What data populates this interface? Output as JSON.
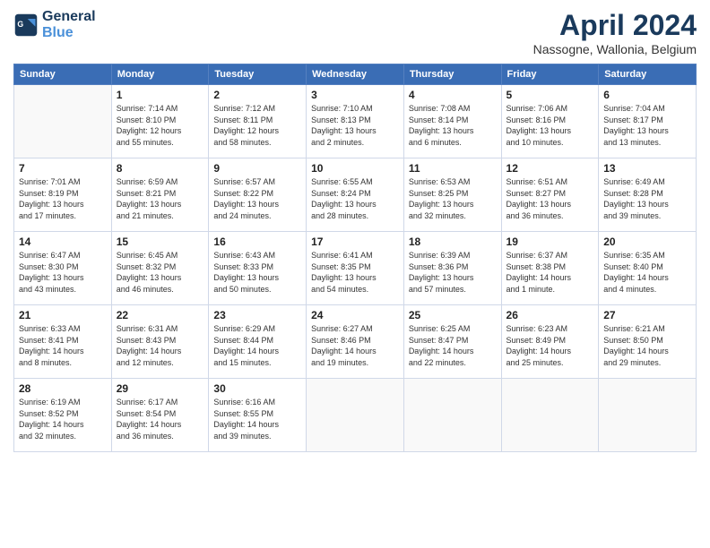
{
  "logo": {
    "line1": "General",
    "line2": "Blue"
  },
  "title": "April 2024",
  "location": "Nassogne, Wallonia, Belgium",
  "days_of_week": [
    "Sunday",
    "Monday",
    "Tuesday",
    "Wednesday",
    "Thursday",
    "Friday",
    "Saturday"
  ],
  "weeks": [
    [
      {
        "day": "",
        "info": ""
      },
      {
        "day": "1",
        "info": "Sunrise: 7:14 AM\nSunset: 8:10 PM\nDaylight: 12 hours\nand 55 minutes."
      },
      {
        "day": "2",
        "info": "Sunrise: 7:12 AM\nSunset: 8:11 PM\nDaylight: 12 hours\nand 58 minutes."
      },
      {
        "day": "3",
        "info": "Sunrise: 7:10 AM\nSunset: 8:13 PM\nDaylight: 13 hours\nand 2 minutes."
      },
      {
        "day": "4",
        "info": "Sunrise: 7:08 AM\nSunset: 8:14 PM\nDaylight: 13 hours\nand 6 minutes."
      },
      {
        "day": "5",
        "info": "Sunrise: 7:06 AM\nSunset: 8:16 PM\nDaylight: 13 hours\nand 10 minutes."
      },
      {
        "day": "6",
        "info": "Sunrise: 7:04 AM\nSunset: 8:17 PM\nDaylight: 13 hours\nand 13 minutes."
      }
    ],
    [
      {
        "day": "7",
        "info": "Sunrise: 7:01 AM\nSunset: 8:19 PM\nDaylight: 13 hours\nand 17 minutes."
      },
      {
        "day": "8",
        "info": "Sunrise: 6:59 AM\nSunset: 8:21 PM\nDaylight: 13 hours\nand 21 minutes."
      },
      {
        "day": "9",
        "info": "Sunrise: 6:57 AM\nSunset: 8:22 PM\nDaylight: 13 hours\nand 24 minutes."
      },
      {
        "day": "10",
        "info": "Sunrise: 6:55 AM\nSunset: 8:24 PM\nDaylight: 13 hours\nand 28 minutes."
      },
      {
        "day": "11",
        "info": "Sunrise: 6:53 AM\nSunset: 8:25 PM\nDaylight: 13 hours\nand 32 minutes."
      },
      {
        "day": "12",
        "info": "Sunrise: 6:51 AM\nSunset: 8:27 PM\nDaylight: 13 hours\nand 36 minutes."
      },
      {
        "day": "13",
        "info": "Sunrise: 6:49 AM\nSunset: 8:28 PM\nDaylight: 13 hours\nand 39 minutes."
      }
    ],
    [
      {
        "day": "14",
        "info": "Sunrise: 6:47 AM\nSunset: 8:30 PM\nDaylight: 13 hours\nand 43 minutes."
      },
      {
        "day": "15",
        "info": "Sunrise: 6:45 AM\nSunset: 8:32 PM\nDaylight: 13 hours\nand 46 minutes."
      },
      {
        "day": "16",
        "info": "Sunrise: 6:43 AM\nSunset: 8:33 PM\nDaylight: 13 hours\nand 50 minutes."
      },
      {
        "day": "17",
        "info": "Sunrise: 6:41 AM\nSunset: 8:35 PM\nDaylight: 13 hours\nand 54 minutes."
      },
      {
        "day": "18",
        "info": "Sunrise: 6:39 AM\nSunset: 8:36 PM\nDaylight: 13 hours\nand 57 minutes."
      },
      {
        "day": "19",
        "info": "Sunrise: 6:37 AM\nSunset: 8:38 PM\nDaylight: 14 hours\nand 1 minute."
      },
      {
        "day": "20",
        "info": "Sunrise: 6:35 AM\nSunset: 8:40 PM\nDaylight: 14 hours\nand 4 minutes."
      }
    ],
    [
      {
        "day": "21",
        "info": "Sunrise: 6:33 AM\nSunset: 8:41 PM\nDaylight: 14 hours\nand 8 minutes."
      },
      {
        "day": "22",
        "info": "Sunrise: 6:31 AM\nSunset: 8:43 PM\nDaylight: 14 hours\nand 12 minutes."
      },
      {
        "day": "23",
        "info": "Sunrise: 6:29 AM\nSunset: 8:44 PM\nDaylight: 14 hours\nand 15 minutes."
      },
      {
        "day": "24",
        "info": "Sunrise: 6:27 AM\nSunset: 8:46 PM\nDaylight: 14 hours\nand 19 minutes."
      },
      {
        "day": "25",
        "info": "Sunrise: 6:25 AM\nSunset: 8:47 PM\nDaylight: 14 hours\nand 22 minutes."
      },
      {
        "day": "26",
        "info": "Sunrise: 6:23 AM\nSunset: 8:49 PM\nDaylight: 14 hours\nand 25 minutes."
      },
      {
        "day": "27",
        "info": "Sunrise: 6:21 AM\nSunset: 8:50 PM\nDaylight: 14 hours\nand 29 minutes."
      }
    ],
    [
      {
        "day": "28",
        "info": "Sunrise: 6:19 AM\nSunset: 8:52 PM\nDaylight: 14 hours\nand 32 minutes."
      },
      {
        "day": "29",
        "info": "Sunrise: 6:17 AM\nSunset: 8:54 PM\nDaylight: 14 hours\nand 36 minutes."
      },
      {
        "day": "30",
        "info": "Sunrise: 6:16 AM\nSunset: 8:55 PM\nDaylight: 14 hours\nand 39 minutes."
      },
      {
        "day": "",
        "info": ""
      },
      {
        "day": "",
        "info": ""
      },
      {
        "day": "",
        "info": ""
      },
      {
        "day": "",
        "info": ""
      }
    ]
  ]
}
